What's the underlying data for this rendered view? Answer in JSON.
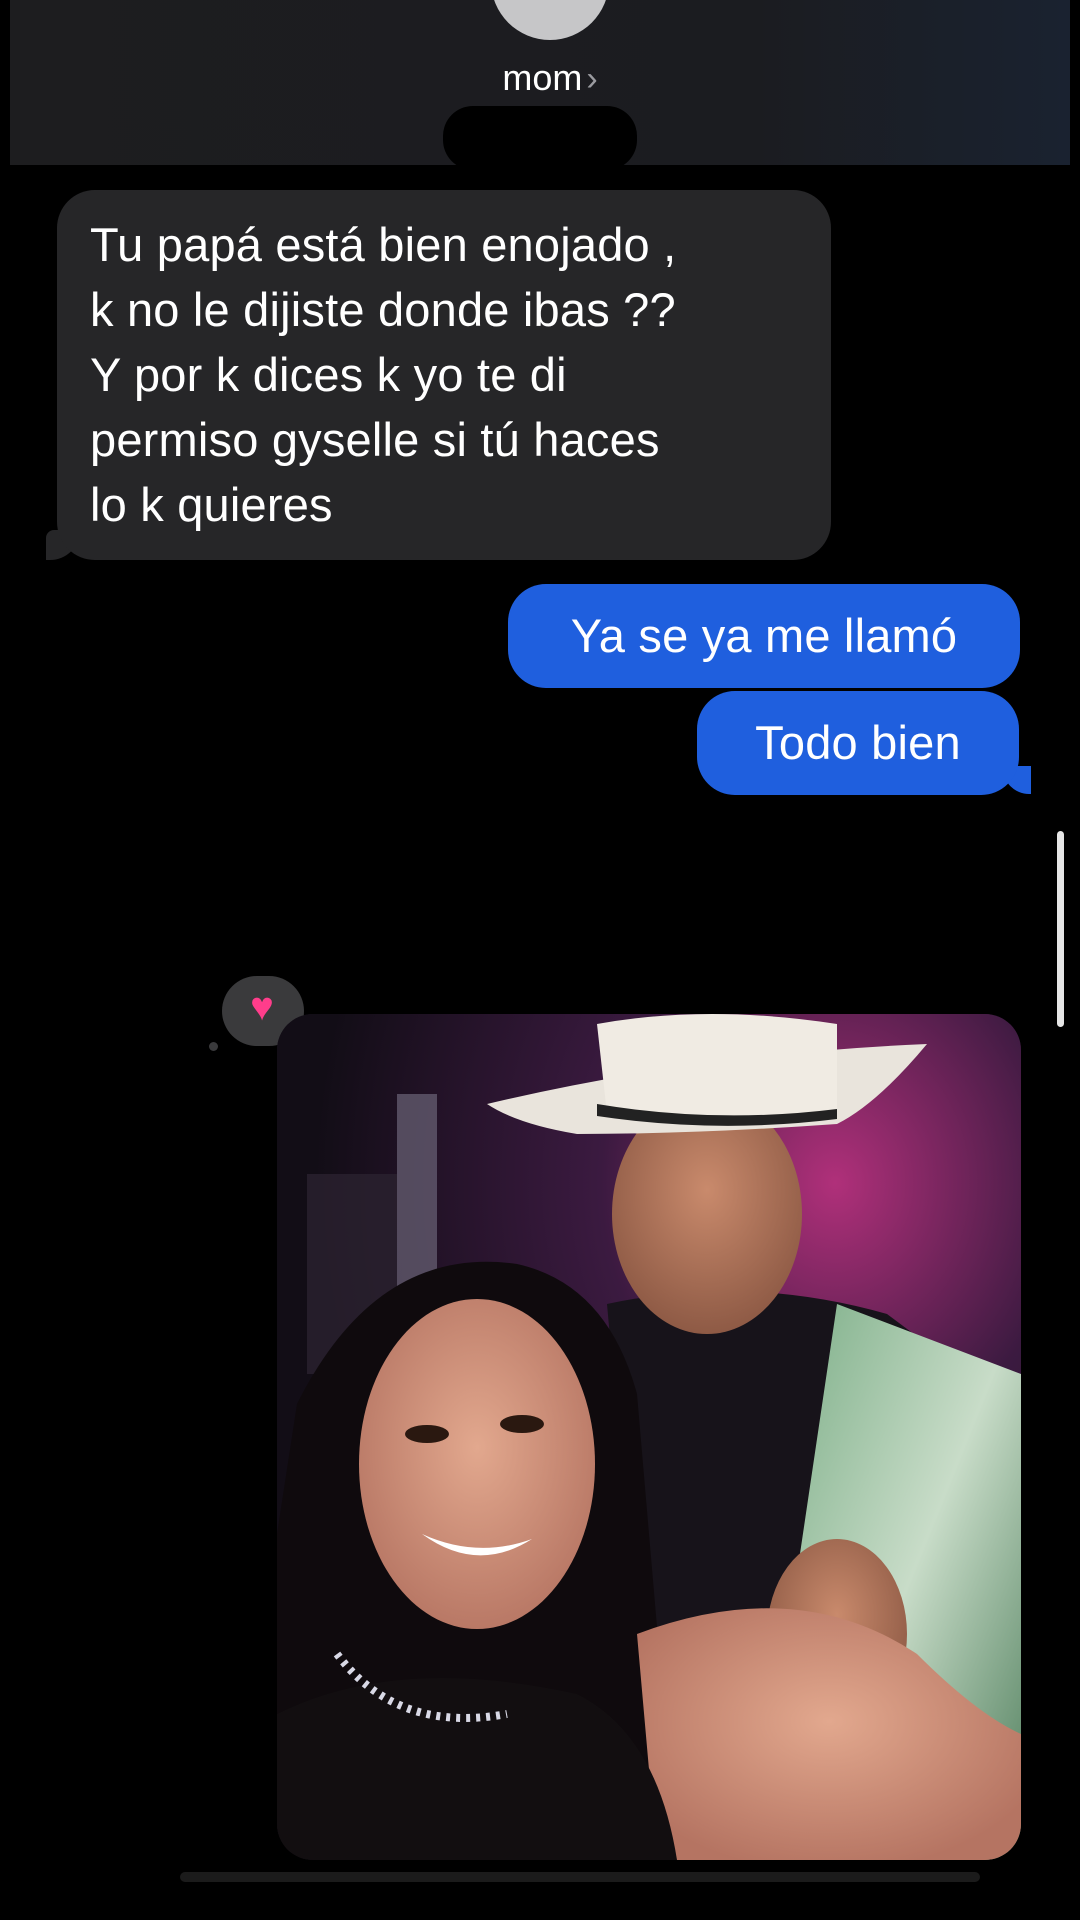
{
  "header": {
    "contact_name": "mom",
    "chevron": "›"
  },
  "messages": {
    "incoming": {
      "lines": [
        "Tu papá está bien enojado ,",
        "k no le dijiste donde ibas ??",
        "Y por k dices k yo te di",
        "permiso gyselle si tú haces",
        "lo k quieres"
      ]
    },
    "outgoing": [
      "Ya se ya me llamó",
      "Todo bien"
    ]
  },
  "tapback": {
    "icon": "heart-icon",
    "symbol": "♥",
    "color": "#ff3d8b"
  },
  "colors": {
    "outgoing_bubble": "#1f5fde",
    "incoming_bubble": "#262628",
    "background": "#000000"
  }
}
